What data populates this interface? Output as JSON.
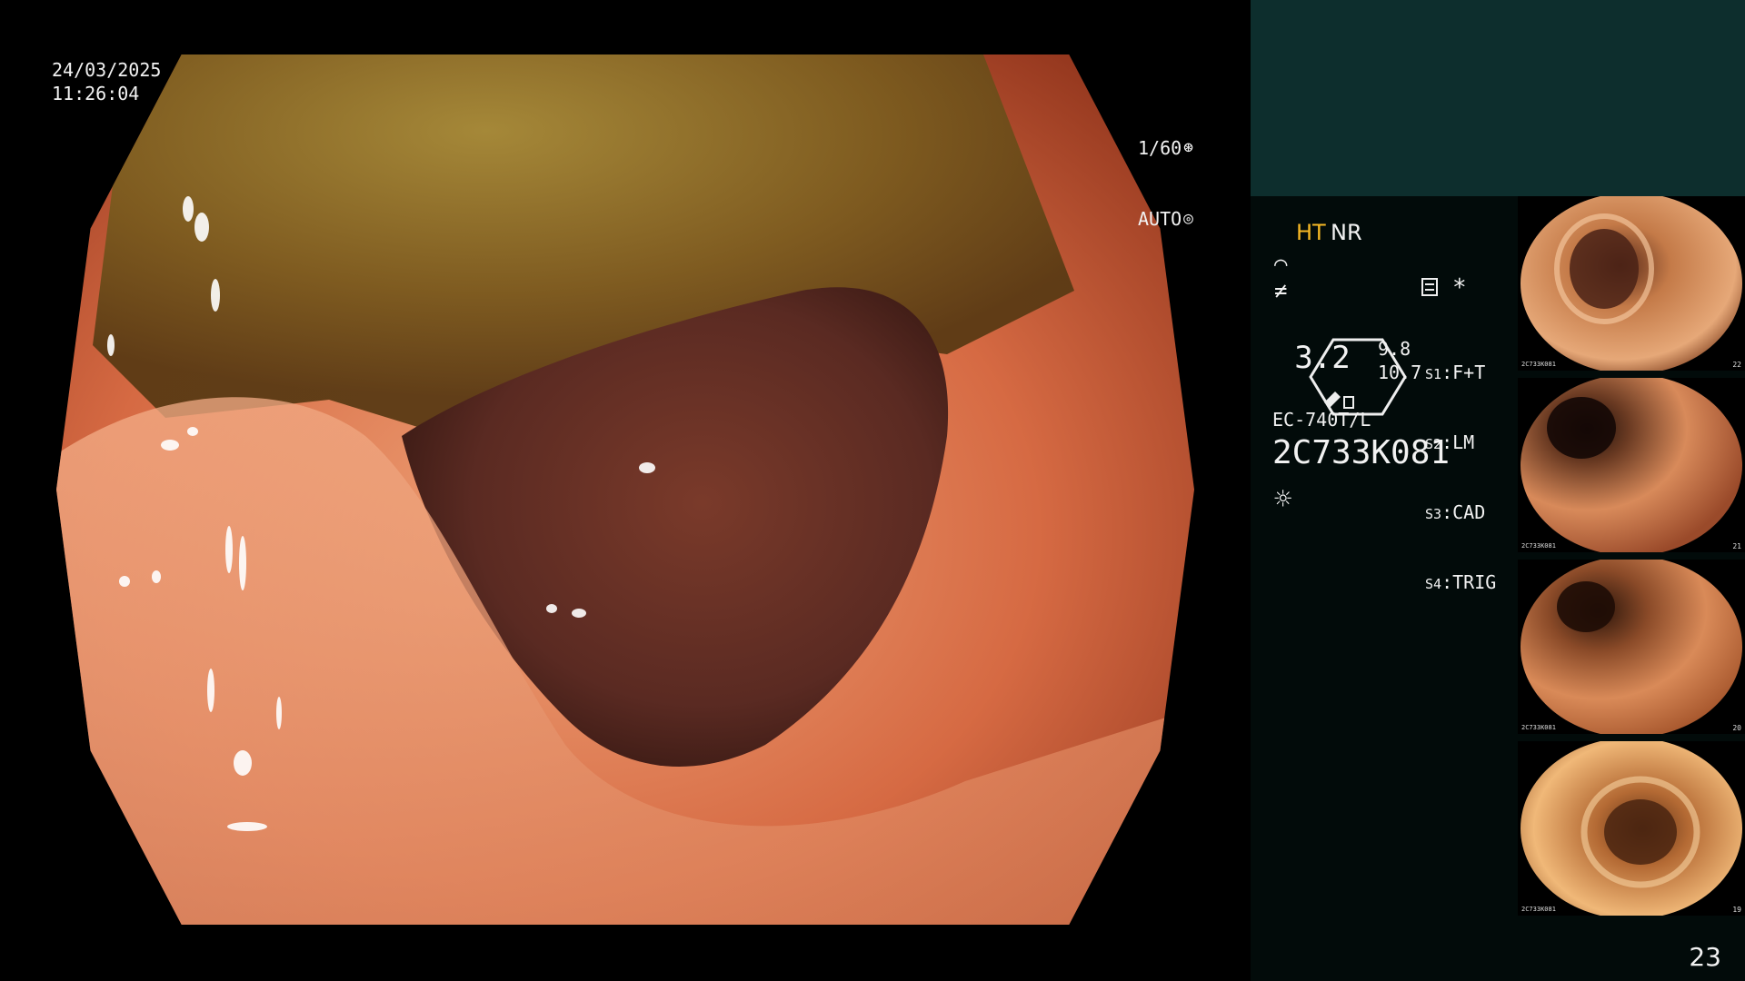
{
  "overlay": {
    "date": "24/03/2025",
    "time": "11:26:04",
    "shutter": "1/60",
    "exposure": "AUTO"
  },
  "side_panel": {
    "mode_ht": "HT",
    "mode_nr": "NR",
    "zoom_value": "3.2",
    "zoom_a": "9.8",
    "zoom_b": "10.7",
    "settings": [
      {
        "key": "S1",
        "value": "F+T"
      },
      {
        "key": "S2",
        "value": "LM"
      },
      {
        "key": "S3",
        "value": "CAD"
      },
      {
        "key": "S4",
        "value": "TRIG"
      }
    ],
    "scope_model": "EC-740T/L",
    "scope_serial": "2C733K081",
    "image_count": "23"
  },
  "thumbnails": [
    {
      "label": "2C733K081",
      "num": "22"
    },
    {
      "label": "2C733K081",
      "num": "21"
    },
    {
      "label": "2C733K081",
      "num": "20"
    },
    {
      "label": "2C733K081",
      "num": "19"
    }
  ],
  "icons": {
    "shutter": "shutter-icon",
    "exposure": "exposure-icon",
    "enhance1": "enhance-curve-icon",
    "enhance2": "enhance-slash-icon",
    "settings": "settings-icon",
    "asterisk": "asterisk-icon",
    "brightness": "sun-icon"
  },
  "colors": {
    "ht_accent": "#f6b824",
    "top_panel": "#0d2e2d",
    "side_panel": "#020b0a"
  }
}
